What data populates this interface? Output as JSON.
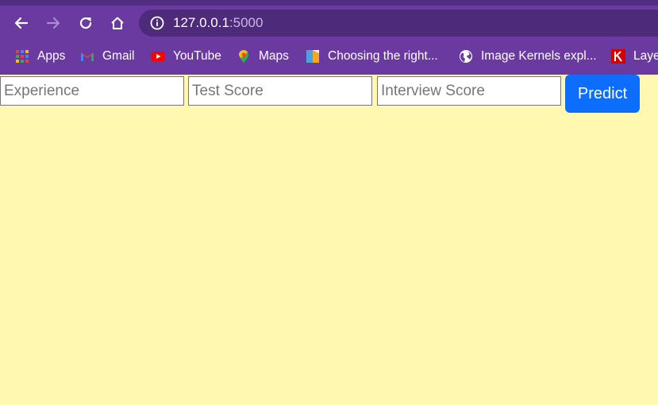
{
  "browser": {
    "url_host": "127.0.0.1",
    "url_port": ":5000",
    "bookmarks": [
      {
        "label": "Apps",
        "icon": "apps-grid-icon"
      },
      {
        "label": "Gmail",
        "icon": "gmail-icon"
      },
      {
        "label": "YouTube",
        "icon": "youtube-icon"
      },
      {
        "label": "Maps",
        "icon": "maps-icon"
      },
      {
        "label": "Choosing the right...",
        "icon": "bookmark-favicon"
      },
      {
        "label": "Image Kernels expl...",
        "icon": "globe-icon"
      },
      {
        "label": "Laye",
        "icon": "k-favicon"
      }
    ],
    "colors": {
      "frame": "#6b3aa0",
      "omnibox": "#4e2a7a"
    }
  },
  "form": {
    "experience_placeholder": "Experience",
    "test_score_placeholder": "Test Score",
    "interview_score_placeholder": "Interview Score",
    "predict_label": "Predict"
  },
  "page": {
    "background": "#fff8b0",
    "accent": "#0d6efd"
  }
}
